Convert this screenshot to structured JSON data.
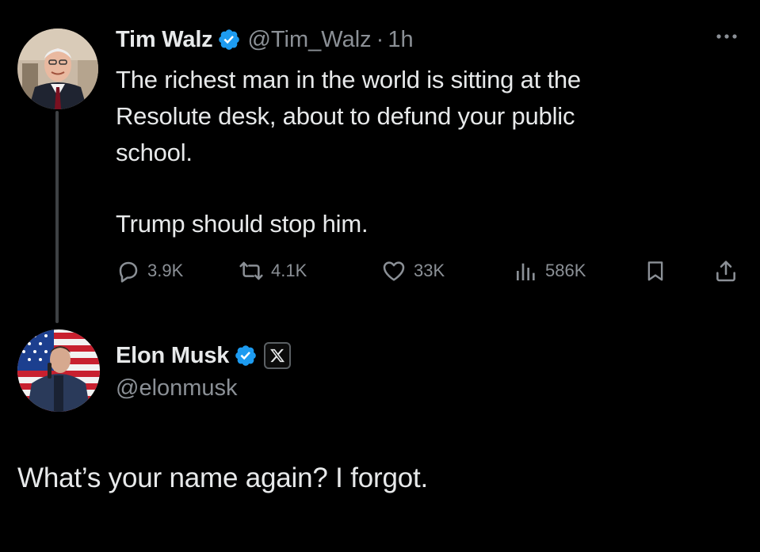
{
  "thread": {
    "tweet": {
      "author_name": "Tim Walz",
      "handle": "@Tim_Walz",
      "separator": "·",
      "time": "1h",
      "text_lines": [
        "The richest man in the world is sitting at the",
        "Resolute desk, about to defund your public",
        "school."
      ],
      "text_line_2": "Trump should stop him.",
      "stats": {
        "replies": "3.9K",
        "reposts": "4.1K",
        "likes": "33K",
        "views": "586K"
      },
      "icons": {
        "verified": "verified-badge-icon",
        "more": "more-icon",
        "reply": "reply-icon",
        "repost": "repost-icon",
        "like": "heart-icon",
        "views": "views-icon",
        "bookmark": "bookmark-icon",
        "share": "share-icon"
      }
    },
    "reply": {
      "author_name": "Elon Musk",
      "handle": "@elonmusk",
      "text": "What’s your name again? I forgot.",
      "icons": {
        "verified": "verified-badge-icon",
        "affiliate": "x-logo-icon"
      }
    }
  },
  "colors": {
    "background": "#000000",
    "text": "#e7e9ea",
    "secondary": "#8b9096",
    "verified": "#1d9bf0",
    "thread_line": "#3e4144"
  }
}
